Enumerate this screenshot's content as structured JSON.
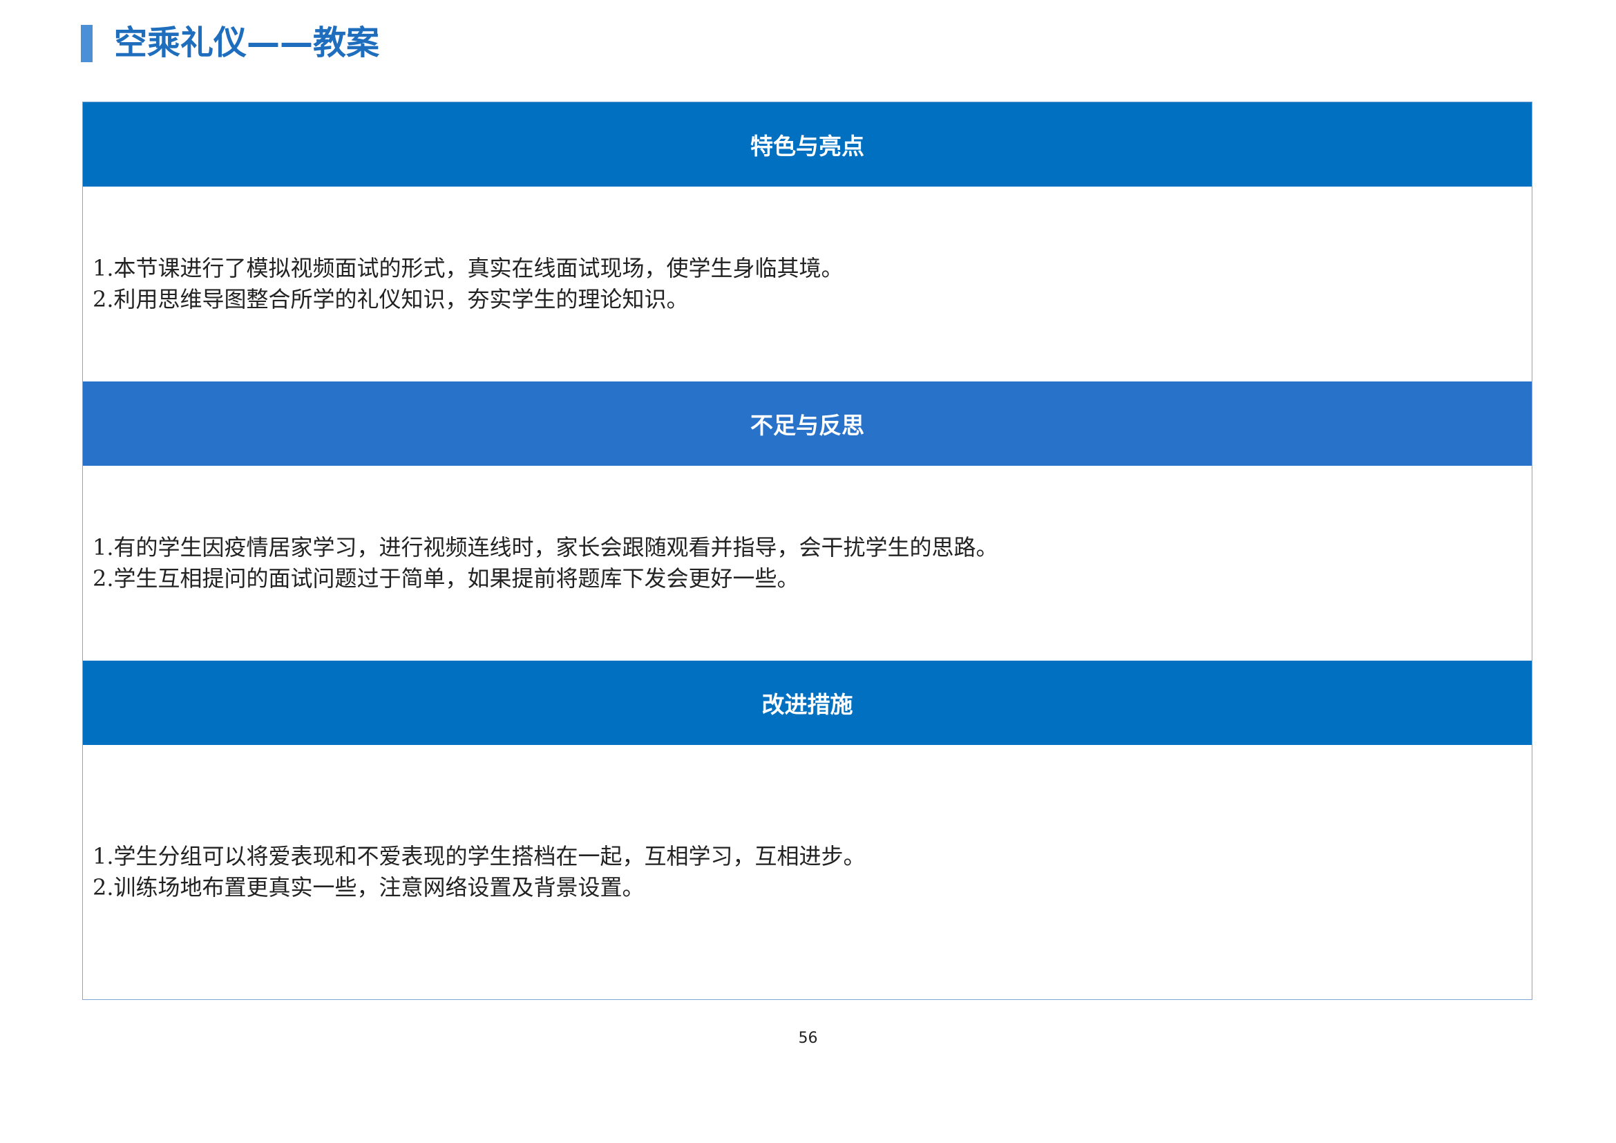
{
  "header": {
    "title": "空乘礼仪——教案"
  },
  "colors": {
    "title": "#1f6dbd",
    "accent_bar": "#4b8fd6",
    "section_1_header": "#0270c1",
    "section_2_header": "#2872c9",
    "section_3_header": "#0270c1",
    "table_border": "#7ea7d3"
  },
  "sections": [
    {
      "heading": "特色与亮点",
      "lines": [
        "1.本节课进行了模拟视频面试的形式，真实在线面试现场，使学生身临其境。",
        "2.利用思维导图整合所学的礼仪知识，夯实学生的理论知识。"
      ]
    },
    {
      "heading": "不足与反思",
      "lines": [
        "1.有的学生因疫情居家学习，进行视频连线时，家长会跟随观看并指导，会干扰学生的思路。",
        "2.学生互相提问的面试问题过于简单，如果提前将题库下发会更好一些。"
      ]
    },
    {
      "heading": "改进措施",
      "lines": [
        "1.学生分组可以将爱表现和不爱表现的学生搭档在一起，互相学习，互相进步。",
        "2.训练场地布置更真实一些，注意网络设置及背景设置。"
      ]
    }
  ],
  "footer": {
    "page_number": "56"
  }
}
